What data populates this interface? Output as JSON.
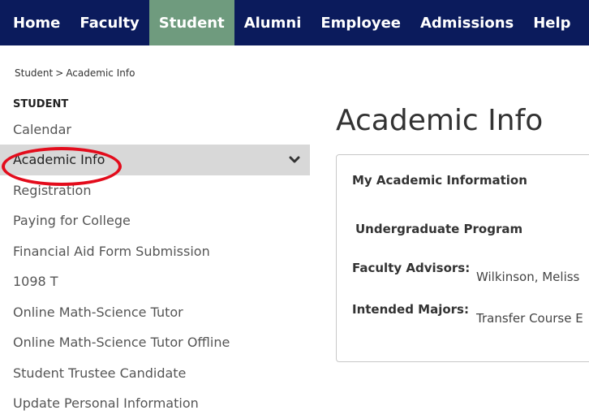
{
  "topnav": {
    "items": [
      {
        "label": "Home",
        "active": false
      },
      {
        "label": "Faculty",
        "active": false
      },
      {
        "label": "Student",
        "active": true
      },
      {
        "label": "Alumni",
        "active": false
      },
      {
        "label": "Employee",
        "active": false
      },
      {
        "label": "Admissions",
        "active": false
      },
      {
        "label": "Help",
        "active": false
      }
    ],
    "active_color": "#6f9b7e",
    "background": "#0b1b5c"
  },
  "breadcrumb": {
    "root": "Student",
    "separator": ">",
    "current": "Academic Info"
  },
  "sidebar": {
    "heading": "STUDENT",
    "items": [
      {
        "label": "Calendar"
      },
      {
        "label": "Academic Info",
        "active": true,
        "icon": "chevron-down-icon"
      },
      {
        "label": "Registration"
      },
      {
        "label": "Paying for College"
      },
      {
        "label": "Financial Aid Form Submission"
      },
      {
        "label": "1098 T"
      },
      {
        "label": "Online Math-Science Tutor"
      },
      {
        "label": "Online Math-Science Tutor Offline"
      },
      {
        "label": "Student Trustee Candidate"
      },
      {
        "label": "Update Personal Information"
      }
    ],
    "annotation_color": "#e30c1c"
  },
  "main": {
    "title": "Academic Info",
    "card": {
      "title": "My Academic Information",
      "program": "Undergraduate Program",
      "fields": [
        {
          "label": "Faculty Advisors:",
          "value": "Wilkinson, Meliss"
        },
        {
          "label": "Intended Majors:",
          "value": "Transfer Course E"
        }
      ]
    }
  }
}
